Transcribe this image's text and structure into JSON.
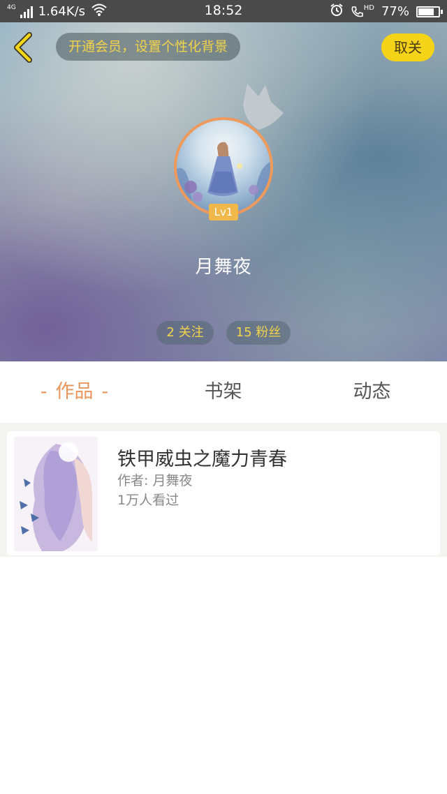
{
  "status_bar": {
    "network_type": "4G",
    "speed": "1.64K/s",
    "time": "18:52",
    "hd_label": "HD",
    "battery": "77%",
    "battery_level": 0.77
  },
  "header": {
    "vip_prompt": "开通会员，设置个性化背景",
    "unfollow_label": "取关",
    "level": "Lv1",
    "username": "月舞夜",
    "following": "2 关注",
    "followers": "15 粉丝"
  },
  "tabs": [
    {
      "label": "作品",
      "active": true
    },
    {
      "label": "书架",
      "active": false
    },
    {
      "label": "动态",
      "active": false
    }
  ],
  "tab_dash": "-",
  "books": [
    {
      "title": "铁甲威虫之魔力青春",
      "author": "作者: 月舞夜",
      "views": "1万人看过"
    }
  ],
  "colors": {
    "accent_orange": "#e9955a",
    "button_yellow": "#f4d318",
    "pill_text_yellow": "#f3d34a",
    "level_badge": "#f0b84a"
  },
  "icons": [
    "back-arrow-icon",
    "crown-icon",
    "wifi-icon",
    "signal-icon",
    "alarm-icon",
    "hd-call-icon",
    "battery-icon"
  ]
}
